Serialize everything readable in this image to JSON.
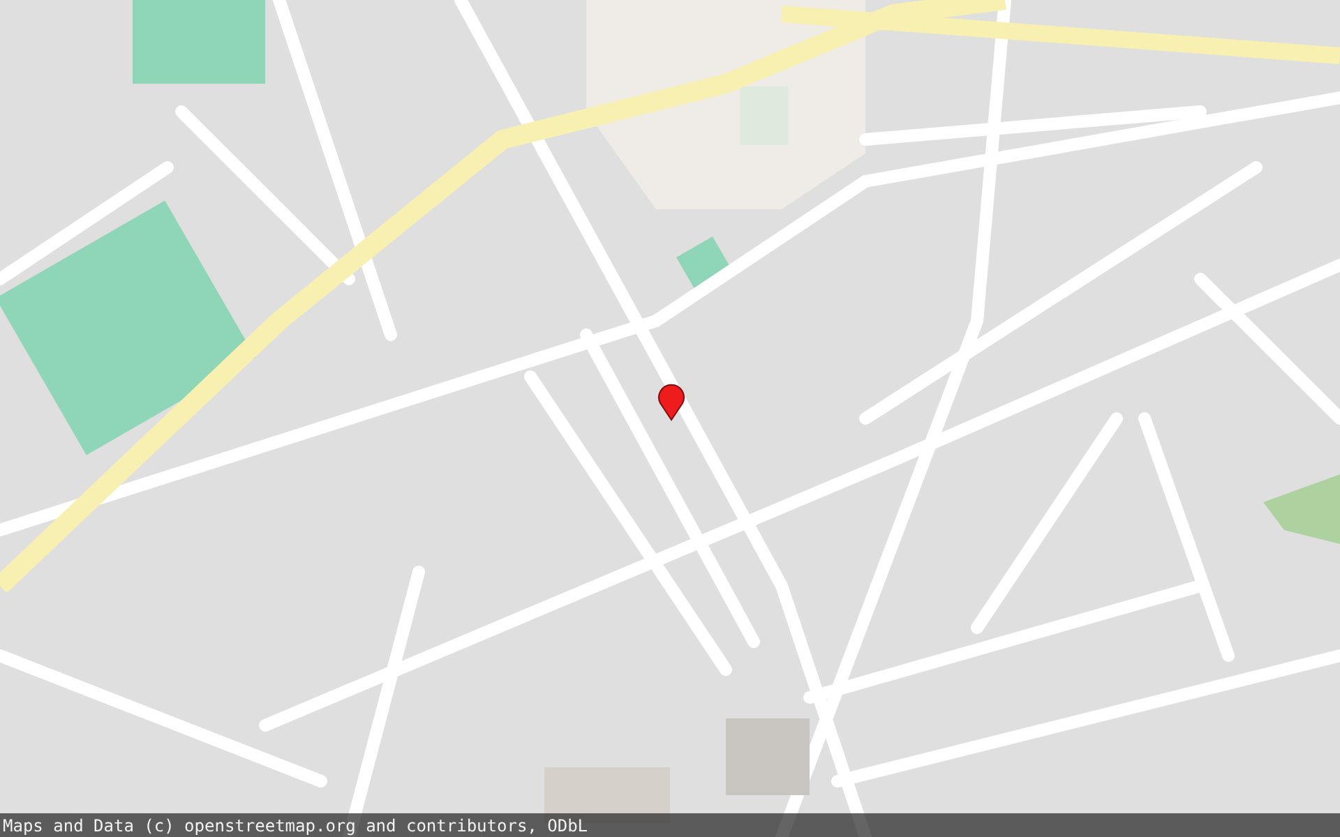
{
  "map": {
    "attribution": "Maps and Data (c) openstreetmap.org and contributors, ODbL",
    "marker": {
      "color": "#ee1c1c"
    }
  }
}
